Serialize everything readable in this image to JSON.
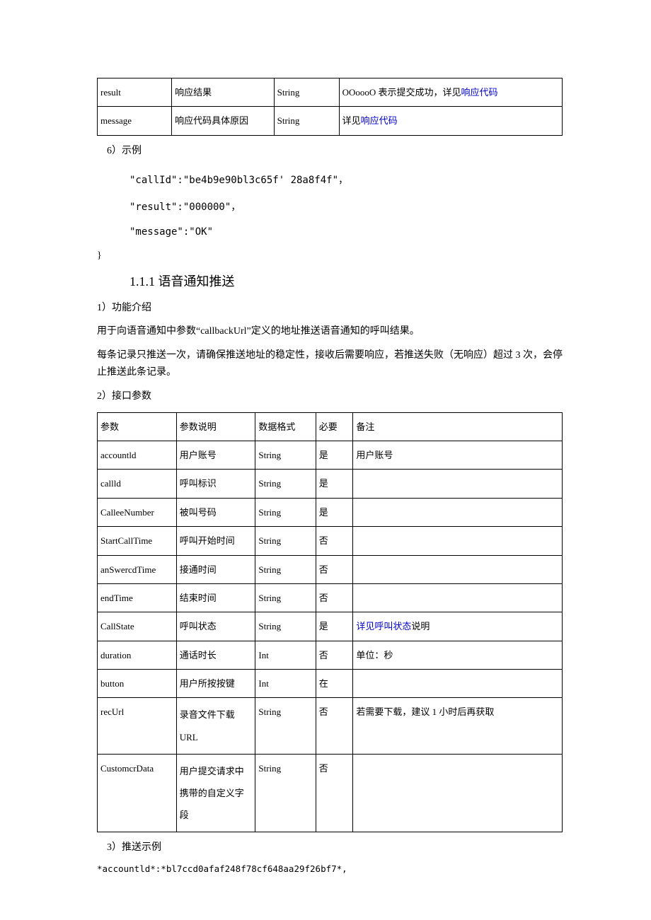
{
  "table1": {
    "rows": [
      {
        "param": "result",
        "desc": "响应结果",
        "fmt": "String",
        "note_prefix": "OOoooO 表示提交成功，详见",
        "note_link": "响应代码",
        "note_suffix": ""
      },
      {
        "param": "message",
        "desc": "响应代码具体原因",
        "fmt": "String",
        "note_prefix": "详见",
        "note_link": "响应代码",
        "note_suffix": ""
      }
    ]
  },
  "example_label": "6）示例",
  "code": {
    "l1": "\"callId\":\"be4b9e90bl3c65f' 28a8f4f\"，",
    "l2": "\"result\":\"000000\"，",
    "l3": "\"message\":\"OK\"",
    "close": "}"
  },
  "heading": "1.1.1 语音通知推送",
  "sec1_title": "1）功能介绍",
  "sec1_p1": "用于向语音通知中参数“callbackUrl”定义的地址推送语音通知的呼叫结果。",
  "sec1_p2": "每条记录只推送一次，请确保推送地址的稳定性，接收后需要响应，若推送失败（无响应）超过 3 次，会停止推送此条记录。",
  "sec2_title": "2）接口参数",
  "table2": {
    "head": {
      "c1": "参数",
      "c2": "参数说明",
      "c3": "数据格式",
      "c4": "必要",
      "c5": "备注"
    },
    "rows": [
      {
        "c1": "accountld",
        "c2": "用户账号",
        "c3": "String",
        "c4": "是",
        "c5_text": "用户账号"
      },
      {
        "c1": "callld",
        "c2": "呼叫标识",
        "c3": "String",
        "c4": "是",
        "c5_text": ""
      },
      {
        "c1": "CalleeNumber",
        "c2": "被叫号码",
        "c3": "String",
        "c4": "是",
        "c5_text": ""
      },
      {
        "c1": "StartCallTime",
        "c2": "呼叫开始时间",
        "c3": "String",
        "c4": "否",
        "c5_text": ""
      },
      {
        "c1": "anSwercdTime",
        "c2": "接通时间",
        "c3": "String",
        "c4": "否",
        "c5_text": ""
      },
      {
        "c1": "endTime",
        "c2": "结束时间",
        "c3": "String",
        "c4": "否",
        "c5_text": ""
      },
      {
        "c1": "CallState",
        "c2": "呼叫状态",
        "c3": "String",
        "c4": "是",
        "c5_link": "详见呼叫状态",
        "c5_suffix": "说明"
      },
      {
        "c1": "duration",
        "c2": "通话时长",
        "c3": "Int",
        "c4": "否",
        "c5_text": "单位：秒"
      },
      {
        "c1": "button",
        "c2": "用户所按按键",
        "c3": "Int",
        "c4": "在",
        "c5_text": ""
      },
      {
        "c1": "recUrl",
        "c2": "录音文件下载 URL",
        "c3": "String",
        "c4": "否",
        "c5_text": "若需要下载，建议 1 小时后再获取"
      },
      {
        "c1": "CustomcrData",
        "c2": "用户提交请求中携带的自定义字段",
        "c3": "String",
        "c4": "否",
        "c5_text": ""
      }
    ]
  },
  "sec3_title": "3）推送示例",
  "push_example": "*accountld*:*bl7ccd0afaf248f78cf648aa29f26bf7*,"
}
